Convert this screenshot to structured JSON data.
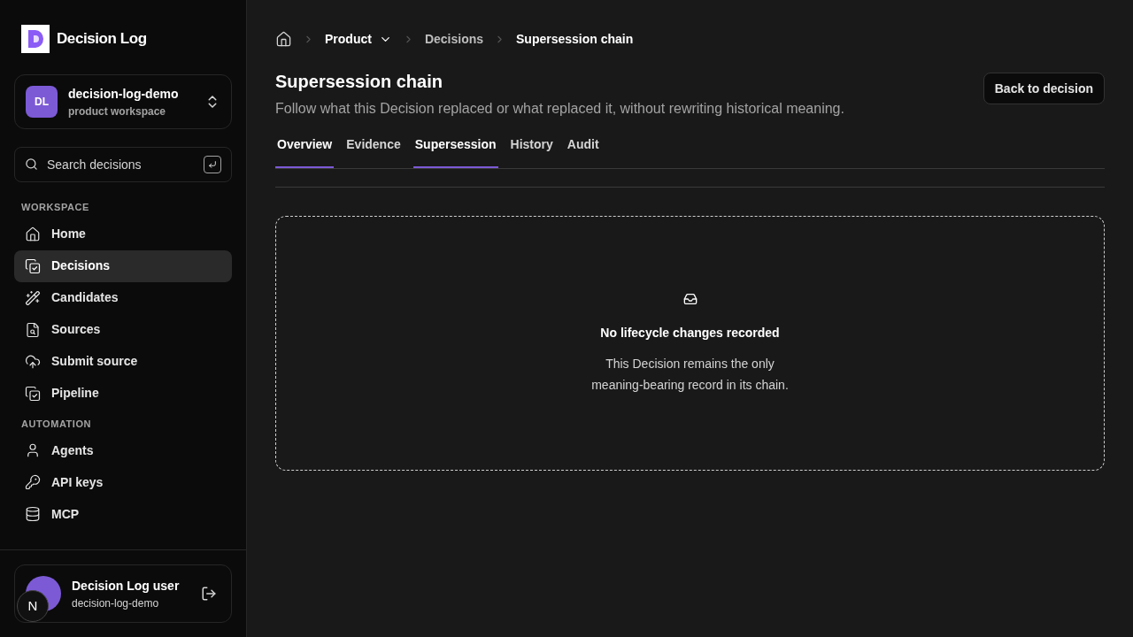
{
  "app": {
    "name": "Decision Log"
  },
  "workspace": {
    "initials": "DL",
    "name": "decision-log-demo",
    "subtitle": "product workspace"
  },
  "search": {
    "placeholder": "Search decisions"
  },
  "nav_sections": [
    {
      "title": "WORKSPACE",
      "items": [
        {
          "label": "Home",
          "selected": false
        },
        {
          "label": "Decisions",
          "selected": true
        },
        {
          "label": "Candidates",
          "selected": false
        },
        {
          "label": "Sources",
          "selected": false
        },
        {
          "label": "Submit source",
          "selected": false
        },
        {
          "label": "Pipeline",
          "selected": false
        }
      ]
    },
    {
      "title": "AUTOMATION",
      "items": [
        {
          "label": "Agents",
          "selected": false
        },
        {
          "label": "API keys",
          "selected": false
        },
        {
          "label": "MCP",
          "selected": false
        }
      ]
    }
  ],
  "user": {
    "name": "Decision Log user",
    "workspace": "decision-log-demo"
  },
  "dev_badge": "N",
  "breadcrumbs": [
    {
      "label": "Product",
      "dropdown": true
    },
    {
      "label": "Decisions",
      "dropdown": false
    },
    {
      "label": "Supersession chain",
      "dropdown": false
    }
  ],
  "page": {
    "title": "Supersession chain",
    "subtitle": "Follow what this Decision replaced or what replaced it, without rewriting historical meaning.",
    "back_button": "Back to decision"
  },
  "tabs": [
    {
      "label": "Overview",
      "selected": true
    },
    {
      "label": "Evidence",
      "selected": false
    },
    {
      "label": "Supersession",
      "selected": true
    },
    {
      "label": "History",
      "selected": false
    },
    {
      "label": "Audit",
      "selected": false
    }
  ],
  "empty_state": {
    "title": "No lifecycle changes recorded",
    "message_lines": [
      "This Decision remains the only",
      "meaning-bearing record in its chain."
    ]
  }
}
